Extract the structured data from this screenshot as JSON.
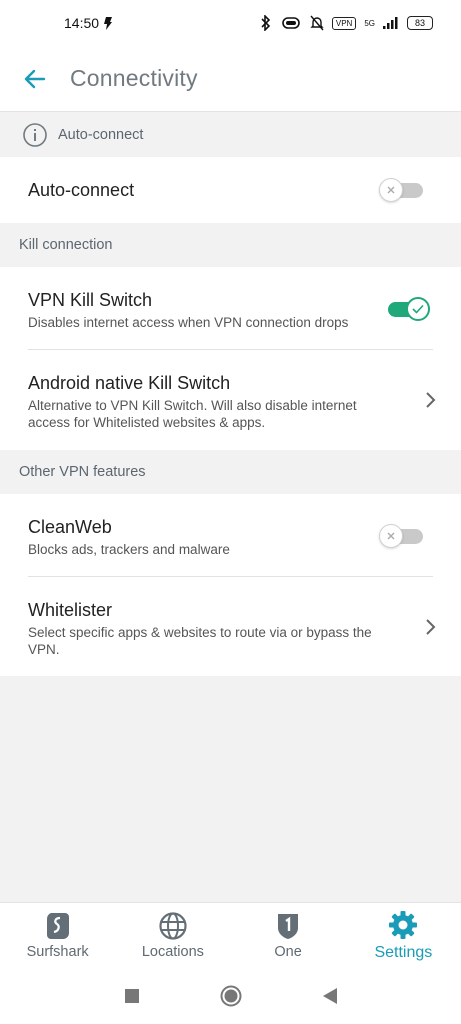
{
  "status_bar": {
    "time": "14:50",
    "network": "5G",
    "vpn_badge": "VPN",
    "battery": "83"
  },
  "app_bar": {
    "title": "Connectivity",
    "back_icon": "arrow-left-icon"
  },
  "sections": {
    "auto_connect_header": "Auto-connect",
    "kill_connection_header": "Kill connection",
    "other_features_header": "Other VPN features"
  },
  "items": {
    "auto_connect": {
      "title": "Auto-connect",
      "enabled": false
    },
    "vpn_kill_switch": {
      "title": "VPN Kill Switch",
      "subtitle": "Disables internet access when VPN connection drops",
      "enabled": true
    },
    "android_kill_switch": {
      "title": "Android native Kill Switch",
      "subtitle": "Alternative to VPN Kill Switch. Will also disable internet access for Whitelisted websites & apps."
    },
    "cleanweb": {
      "title": "CleanWeb",
      "subtitle": "Blocks ads, trackers and malware",
      "enabled": false
    },
    "whitelister": {
      "title": "Whitelister",
      "subtitle": "Select specific apps & websites to route via or bypass the VPN."
    }
  },
  "bottom_nav": [
    {
      "label": "Surfshark",
      "icon": "surfshark-logo-icon",
      "active": false
    },
    {
      "label": "Locations",
      "icon": "globe-icon",
      "active": false
    },
    {
      "label": "One",
      "icon": "one-shield-icon",
      "active": false
    },
    {
      "label": "Settings",
      "icon": "gear-icon",
      "active": true
    }
  ],
  "colors": {
    "accent": "#1a9bb8",
    "toggle_on": "#1fa97a",
    "toggle_off": "#c9c9c9",
    "background": "#f2f2f2"
  }
}
